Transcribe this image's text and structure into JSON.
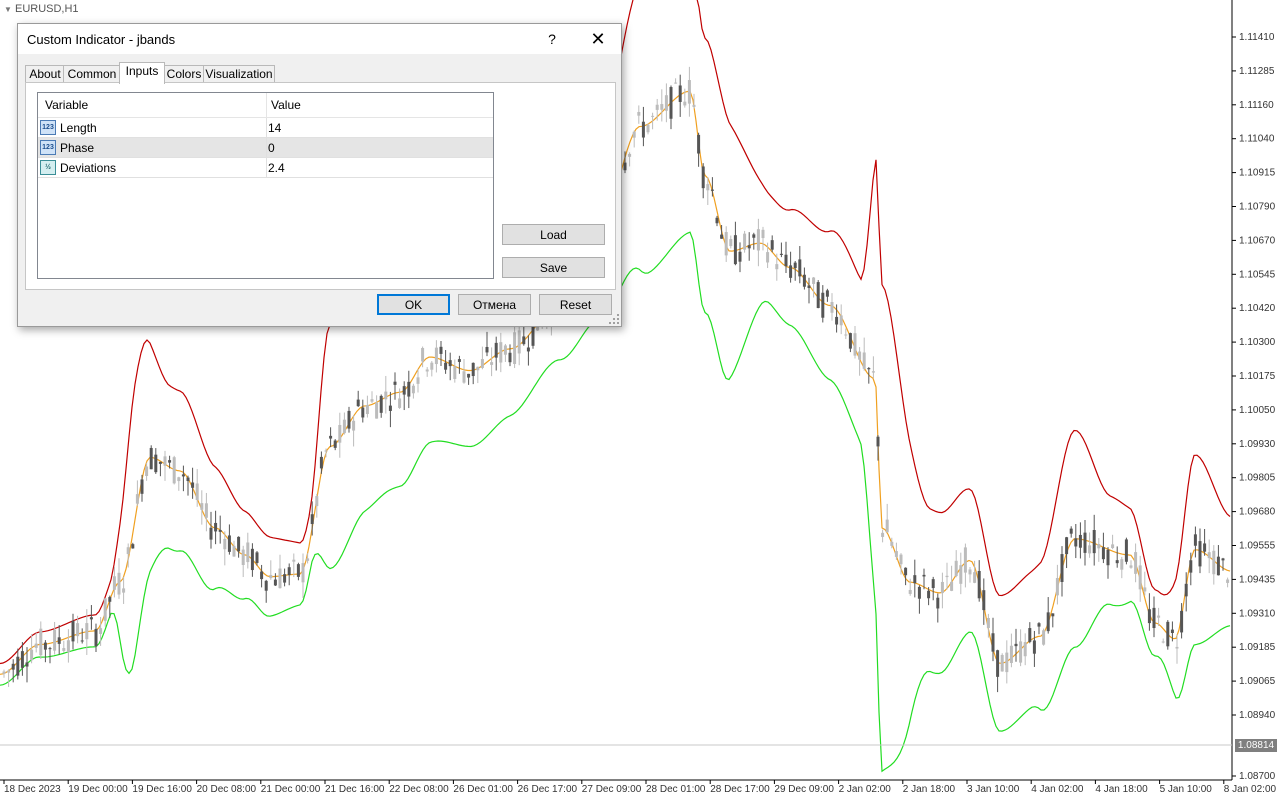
{
  "chart": {
    "symbol_label": "EURUSD,H1",
    "price_scale": [
      "1.11410",
      "1.11285",
      "1.11160",
      "1.11040",
      "1.10915",
      "1.10790",
      "1.10670",
      "1.10545",
      "1.10420",
      "1.10300",
      "1.10175",
      "1.10050",
      "1.09930",
      "1.09805",
      "1.09680",
      "1.09555",
      "1.09435",
      "1.09310",
      "1.09185",
      "1.09065",
      "1.08940",
      "1.08700"
    ],
    "current_price": "1.08814",
    "time_scale": [
      "18 Dec 2023",
      "19 Dec 00:00",
      "19 Dec 16:00",
      "20 Dec 08:00",
      "21 Dec 00:00",
      "21 Dec 16:00",
      "22 Dec 08:00",
      "26 Dec 01:00",
      "26 Dec 17:00",
      "27 Dec 09:00",
      "28 Dec 01:00",
      "28 Dec 17:00",
      "29 Dec 09:00",
      "2 Jan 02:00",
      "2 Jan 18:00",
      "3 Jan 10:00",
      "4 Jan 02:00",
      "4 Jan 18:00",
      "5 Jan 10:00",
      "8 Jan 02:00"
    ],
    "colors": {
      "upper_band": "#c00000",
      "lower_band": "#22dd22",
      "middle_line": "#f0a020",
      "candle_up": "#bcbcbc",
      "candle_down": "#555555"
    }
  },
  "dialog": {
    "title": "Custom Indicator - jbands",
    "help_label": "?",
    "close_label": "✕",
    "tabs": [
      {
        "label": "About"
      },
      {
        "label": "Common"
      },
      {
        "label": "Inputs"
      },
      {
        "label": "Colors"
      },
      {
        "label": "Visualization"
      }
    ],
    "active_tab": "Inputs",
    "table": {
      "col_variable": "Variable",
      "col_value": "Value",
      "rows": [
        {
          "icon": "123",
          "name": "Length",
          "value": "14"
        },
        {
          "icon": "123",
          "name": "Phase",
          "value": "0"
        },
        {
          "icon": "½",
          "name": "Deviations",
          "value": "2.4"
        }
      ]
    },
    "load_label": "Load",
    "save_label": "Save",
    "ok_label": "OK",
    "cancel_label": "Отмена",
    "reset_label": "Reset"
  }
}
